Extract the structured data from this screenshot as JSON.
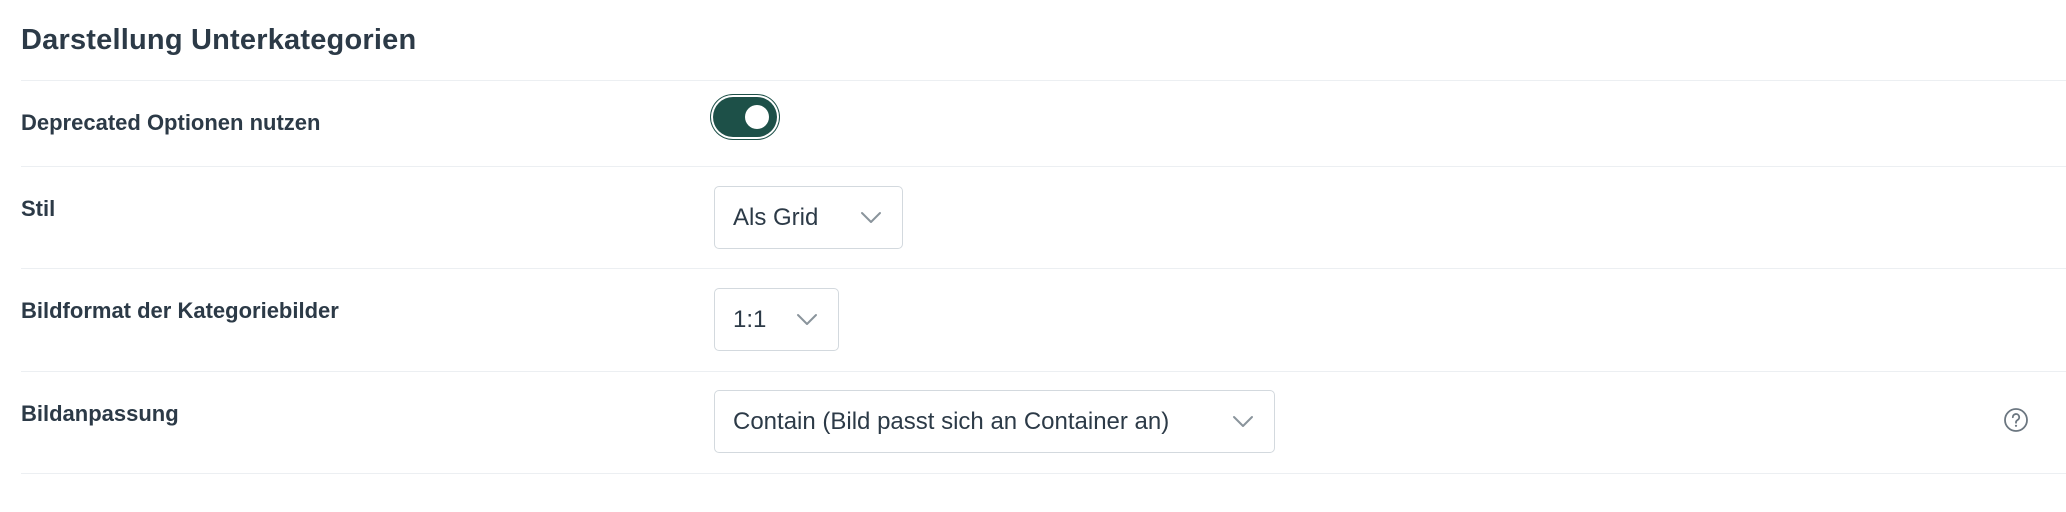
{
  "section": {
    "title": "Darstellung Unterkategorien"
  },
  "settings": {
    "deprecated": {
      "label": "Deprecated Optionen nutzen",
      "enabled": true
    },
    "style": {
      "label": "Stil",
      "value": "Als Grid"
    },
    "image_format": {
      "label": "Bildformat der Kategoriebilder",
      "value": "1:1"
    },
    "image_fit": {
      "label": "Bildanpassung",
      "value": "Contain (Bild passt sich an Container an)"
    }
  },
  "icons": {
    "chevron": "chevron-down-icon",
    "help": "question-circle-icon"
  },
  "colors": {
    "toggle_on": "#1d5048",
    "text": "#2c3a47",
    "border": "#d3d9de",
    "divider": "#eceff2"
  }
}
